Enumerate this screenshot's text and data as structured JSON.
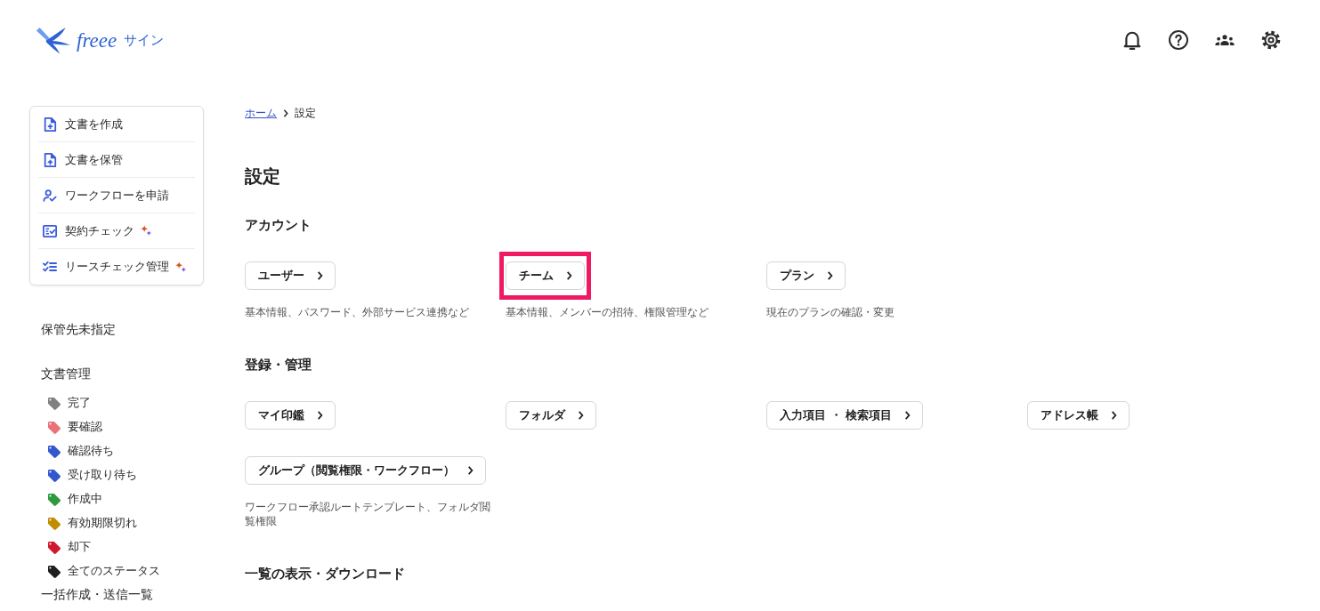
{
  "header": {
    "logo": {
      "wordmark": "freee",
      "product": "サイン"
    }
  },
  "sidebar": {
    "actions": [
      {
        "label": "文書を作成",
        "kind": "create",
        "sparkle": false
      },
      {
        "label": "文書を保管",
        "kind": "upload",
        "sparkle": false
      },
      {
        "label": "ワークフローを申請",
        "kind": "workflow",
        "sparkle": false
      },
      {
        "label": "契約チェック",
        "kind": "review",
        "sparkle": true
      },
      {
        "label": "リースチェック管理",
        "kind": "checklist",
        "sparkle": true
      }
    ],
    "groups": [
      {
        "title": "保管先未指定"
      },
      {
        "title": "文書管理",
        "tags": [
          {
            "label": "完了",
            "color": "#808080"
          },
          {
            "label": "要確認",
            "color": "#e8737a"
          },
          {
            "label": "確認待ち",
            "color": "#3358cc"
          },
          {
            "label": "受け取り待ち",
            "color": "#3358cc"
          },
          {
            "label": "作成中",
            "color": "#2e9a3e"
          },
          {
            "label": "有効期限切れ",
            "color": "#c08c00"
          },
          {
            "label": "却下",
            "color": "#d0182e"
          },
          {
            "label": "全てのステータス",
            "color": "#1e1e1e"
          }
        ]
      },
      {
        "title": "一括作成・送信一覧"
      }
    ]
  },
  "main": {
    "breadcrumb": [
      {
        "label": "ホーム",
        "link": true
      },
      {
        "label": "設定",
        "link": false
      }
    ],
    "title": "設定",
    "sections": [
      {
        "title": "アカウント",
        "items": [
          {
            "label": "ユーザー",
            "description": "基本情報、パスワード、外部サービス連携など",
            "highlighted": false
          },
          {
            "label": "チーム",
            "description": "基本情報、メンバーの招待、権限管理など",
            "highlighted": true
          },
          {
            "label": "プラン",
            "description": "現在のプランの確認・変更",
            "highlighted": false
          }
        ]
      },
      {
        "title": "登録・管理",
        "items": [
          {
            "label": "マイ印鑑",
            "highlighted": false
          },
          {
            "label": "フォルダ",
            "highlighted": false
          },
          {
            "label": "入力項目 ・ 検索項目",
            "highlighted": false
          },
          {
            "label": "アドレス帳",
            "highlighted": false
          },
          {
            "label": "グループ（閲覧権限・ワークフロー）",
            "description": "ワークフロー承認ルートテンプレート、フォルダ閲覧権限",
            "highlighted": false
          }
        ]
      },
      {
        "title": "一覧の表示・ダウンロード"
      }
    ]
  }
}
